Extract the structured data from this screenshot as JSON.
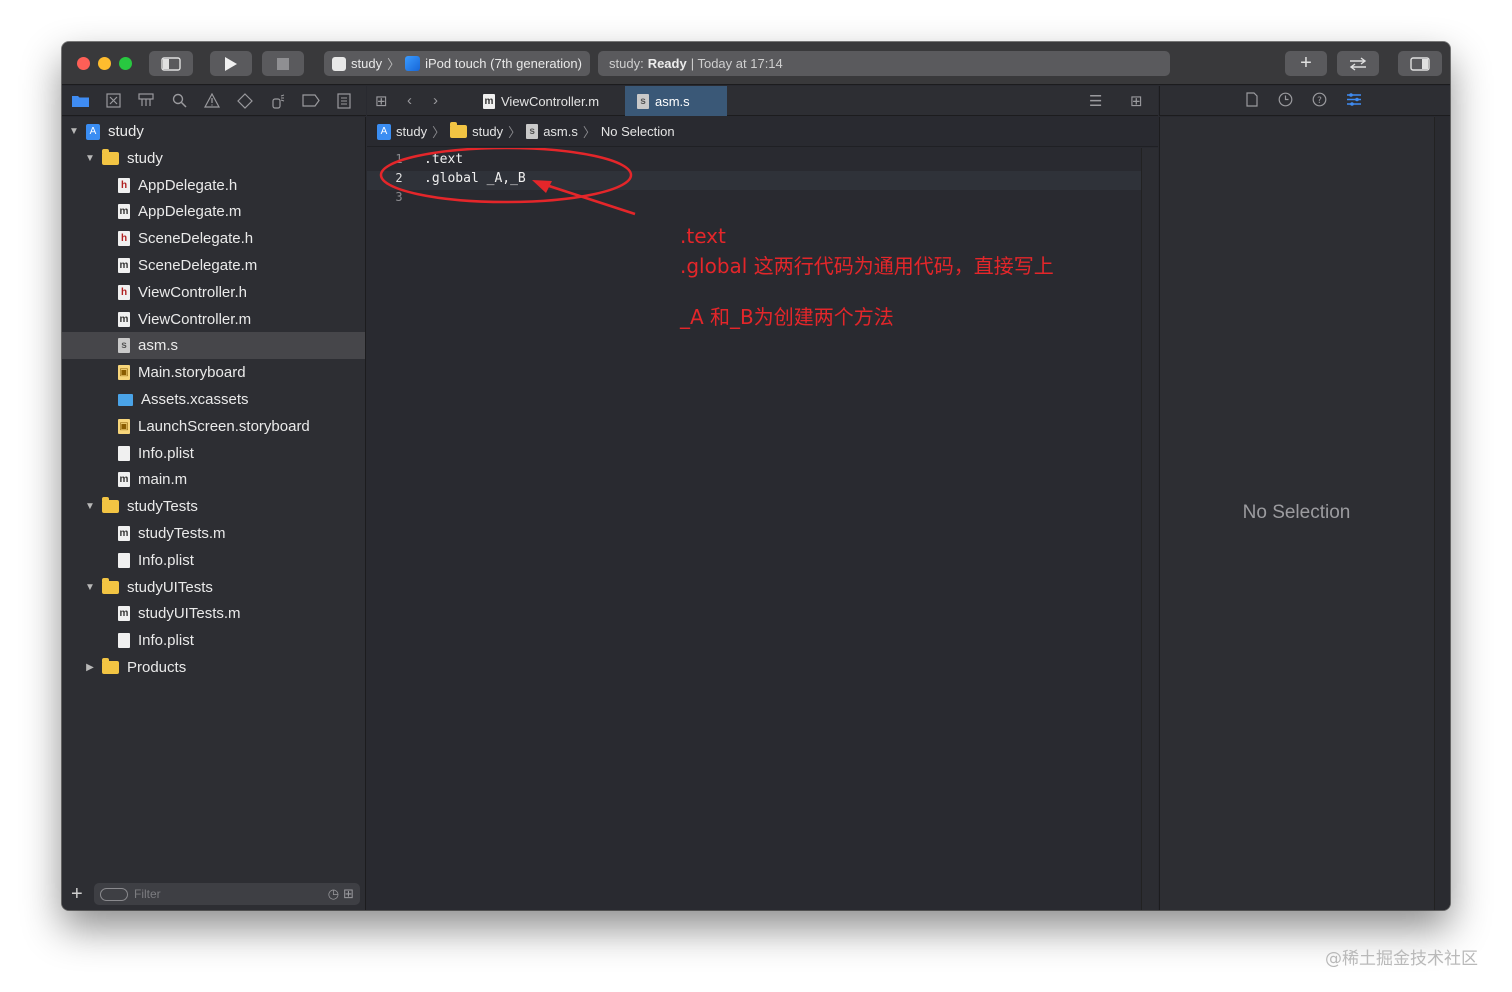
{
  "toolbar": {
    "scheme": "study",
    "destination": "iPod touch (7th generation)",
    "status_prefix": "study:",
    "status_state": "Ready",
    "status_time": "| Today at 17:14"
  },
  "navigator_tree": [
    {
      "label": "study",
      "kind": "project",
      "depth": 0,
      "expanded": true
    },
    {
      "label": "study",
      "kind": "folder",
      "depth": 1,
      "expanded": true
    },
    {
      "label": "AppDelegate.h",
      "kind": "h",
      "depth": 2
    },
    {
      "label": "AppDelegate.m",
      "kind": "m",
      "depth": 2
    },
    {
      "label": "SceneDelegate.h",
      "kind": "h",
      "depth": 2
    },
    {
      "label": "SceneDelegate.m",
      "kind": "m",
      "depth": 2
    },
    {
      "label": "ViewController.h",
      "kind": "h",
      "depth": 2
    },
    {
      "label": "ViewController.m",
      "kind": "m",
      "depth": 2
    },
    {
      "label": "asm.s",
      "kind": "s",
      "depth": 2,
      "selected": true
    },
    {
      "label": "Main.storyboard",
      "kind": "storyboard",
      "depth": 2
    },
    {
      "label": "Assets.xcassets",
      "kind": "xcassets",
      "depth": 2
    },
    {
      "label": "LaunchScreen.storyboard",
      "kind": "storyboard",
      "depth": 2
    },
    {
      "label": "Info.plist",
      "kind": "plist",
      "depth": 2
    },
    {
      "label": "main.m",
      "kind": "m",
      "depth": 2
    },
    {
      "label": "studyTests",
      "kind": "folder",
      "depth": 1,
      "expanded": true
    },
    {
      "label": "studyTests.m",
      "kind": "m",
      "depth": 2
    },
    {
      "label": "Info.plist",
      "kind": "plist",
      "depth": 2
    },
    {
      "label": "studyUITests",
      "kind": "folder",
      "depth": 1,
      "expanded": true
    },
    {
      "label": "studyUITests.m",
      "kind": "m",
      "depth": 2
    },
    {
      "label": "Info.plist",
      "kind": "plist",
      "depth": 2
    },
    {
      "label": "Products",
      "kind": "folder",
      "depth": 1,
      "expanded": false
    }
  ],
  "filter": {
    "placeholder": "Filter"
  },
  "tabs": [
    {
      "label": "ViewController.m",
      "active": false
    },
    {
      "label": "asm.s",
      "active": true
    }
  ],
  "jumpbar": {
    "project": "study",
    "folder": "study",
    "file": "asm.s",
    "selection": "No Selection"
  },
  "code_lines": [
    {
      "num": "1",
      "text": ".text"
    },
    {
      "num": "2",
      "text": ".global _A,_B"
    },
    {
      "num": "3",
      "text": ""
    }
  ],
  "annotation": {
    "line1": ".text",
    "line2": ".global 这两行代码为通用代码，直接写上",
    "line3": "_A 和_B为创建两个方法",
    "color": "#e4262a"
  },
  "inspector": {
    "empty_text": "No Selection"
  },
  "watermark": "@稀土掘金技术社区",
  "colors": {
    "accent": "#3f8cf3",
    "active_tab": "#3a5877",
    "selected_row": "#46464a"
  }
}
